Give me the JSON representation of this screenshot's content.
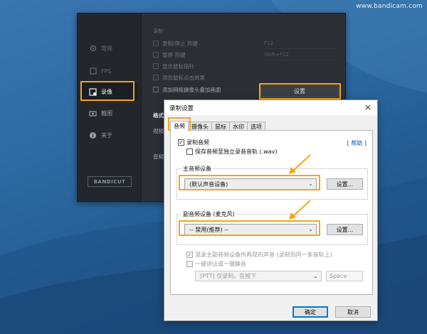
{
  "watermark": "www.bandicam.com",
  "main_window": {
    "sidebar": [
      {
        "label": "常规",
        "icon": "home-icon"
      },
      {
        "label": "FPS",
        "icon": "fps-icon"
      },
      {
        "label": "录像",
        "icon": "video-record-icon"
      },
      {
        "label": "截图",
        "icon": "camera-icon"
      },
      {
        "label": "关于",
        "icon": "info-icon"
      }
    ],
    "logo": "BANDICUT",
    "section_title": "录制",
    "options": [
      {
        "label": "录制/停止 热键",
        "checked": true,
        "hotkey": "F12"
      },
      {
        "label": "暂停 热键",
        "checked": false,
        "hotkey": "Shift+F12"
      },
      {
        "label": "显示鼠标指针",
        "checked": false,
        "hotkey": ""
      },
      {
        "label": "添加鼠标点击效果",
        "checked": false,
        "hotkey": ""
      },
      {
        "label": "添加网络摄像头叠加画面",
        "checked": false,
        "hotkey": ""
      }
    ],
    "settings_button": "设置",
    "format_label": "格式",
    "video_label": "视频",
    "audio_label": "音频"
  },
  "dialog": {
    "title": "录制设置",
    "close": "×",
    "tabs": [
      "音频",
      "摄像头",
      "鼠标",
      "水印",
      "选项"
    ],
    "active_tab": "音频",
    "record_audio": {
      "label": "录制音频",
      "checked": true
    },
    "save_separate": {
      "label": "保存音频至独立录音音轨 (.wav)",
      "checked": false
    },
    "help": "[ 帮助 ]",
    "primary_device": {
      "group_label": "主音频设备",
      "value": "(默认声音设备)",
      "settings_button": "设置..."
    },
    "secondary_device": {
      "group_label": "副音频设备 (麦克风)",
      "value": "-- 禁用(推荐) --",
      "settings_button": "设置..."
    },
    "mix_option": {
      "label": "混录主副音频设备所再现的声音 (录制到同一条音轨上)",
      "checked": true,
      "enabled": false
    },
    "ptt_option": {
      "label": "一键讲话或一键静音",
      "checked": false,
      "enabled": false
    },
    "ptt_mode": "[PTT] 仅录制，在按下",
    "ptt_key": "Space",
    "ok_button": "确定",
    "cancel_button": "取消"
  },
  "colors": {
    "highlight": "#f5a519",
    "link": "#0a4fc4",
    "dark_window": "#2b2f35"
  }
}
